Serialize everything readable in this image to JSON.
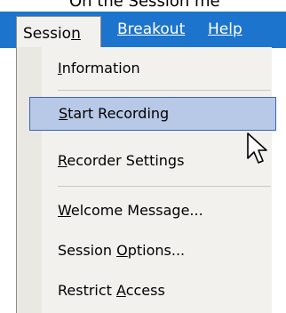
{
  "instruction_fragment": "On the Session me",
  "menubar": {
    "items": [
      {
        "pre": "Sessio",
        "ul": "n",
        "post": "",
        "active": true
      },
      {
        "pre": "",
        "ul": "B",
        "post": "reakout",
        "active": false
      },
      {
        "pre": "",
        "ul": "H",
        "post": "elp",
        "active": false
      }
    ]
  },
  "menu": {
    "items": [
      {
        "pre": "",
        "ul": "I",
        "post": "nformation"
      },
      {
        "pre": "",
        "ul": "S",
        "post": "tart Recording",
        "highlighted": true
      },
      {
        "pre": "",
        "ul": "R",
        "post": "ecorder Settings"
      },
      {
        "pre": "",
        "ul": "W",
        "post": "elcome Message..."
      },
      {
        "pre": "Session ",
        "ul": "O",
        "post": "ptions..."
      },
      {
        "pre": "Restrict ",
        "ul": "A",
        "post": "ccess"
      }
    ]
  },
  "colors": {
    "menubar_bg": "#1c74cc",
    "menu_bg": "#f2f1ee",
    "highlight_bg": "#b8c8e7",
    "highlight_border": "#3a64b5"
  },
  "cursor": "arrow-pointer-icon"
}
